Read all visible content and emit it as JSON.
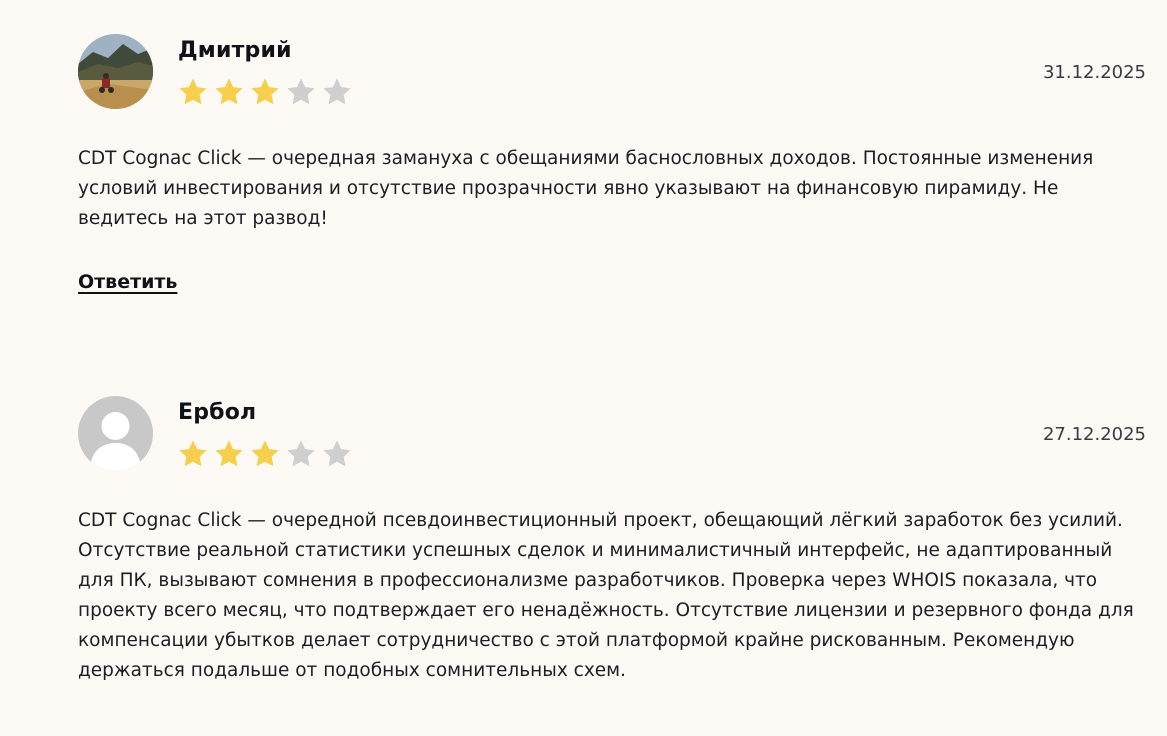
{
  "reviews": [
    {
      "author": "Дмитрий",
      "date": "31.12.2025",
      "rating": 3,
      "rating_max": 5,
      "avatar": "photo-avatar",
      "text": "CDT Cognac Click — очередная замануха с обещаниями баснословных доходов. Постоянные изменения условий инвестирования и отсутствие прозрачности явно указывают на финансовую пирамиду. Не ведитесь на этот развод!",
      "reply_label": "Ответить"
    },
    {
      "author": "Ербол",
      "date": "27.12.2025",
      "rating": 3,
      "rating_max": 5,
      "avatar": "default-user-avatar",
      "text": "CDT Cognac Click — очередной псевдоинвестиционный проект, обещающий лёгкий заработок без усилий. Отсутствие реальной статистики успешных сделок и минималистичный интерфейс, не адаптированный для ПК, вызывают сомнения в профессионализме разработчиков. Проверка через WHOIS показала, что проекту всего месяц, что подтверждает его ненадёжность. Отсутствие лицензии и резервного фонда для компенсации убытков делает сотрудничество с этой платформой крайне рискованным. Рекомендую держаться подальше от подобных сомнительных схем."
    }
  ],
  "colors": {
    "background": "#fdfaf6",
    "star_filled": "#f7cf4d",
    "star_empty": "#cfcfcf",
    "text": "#1d1d24"
  }
}
